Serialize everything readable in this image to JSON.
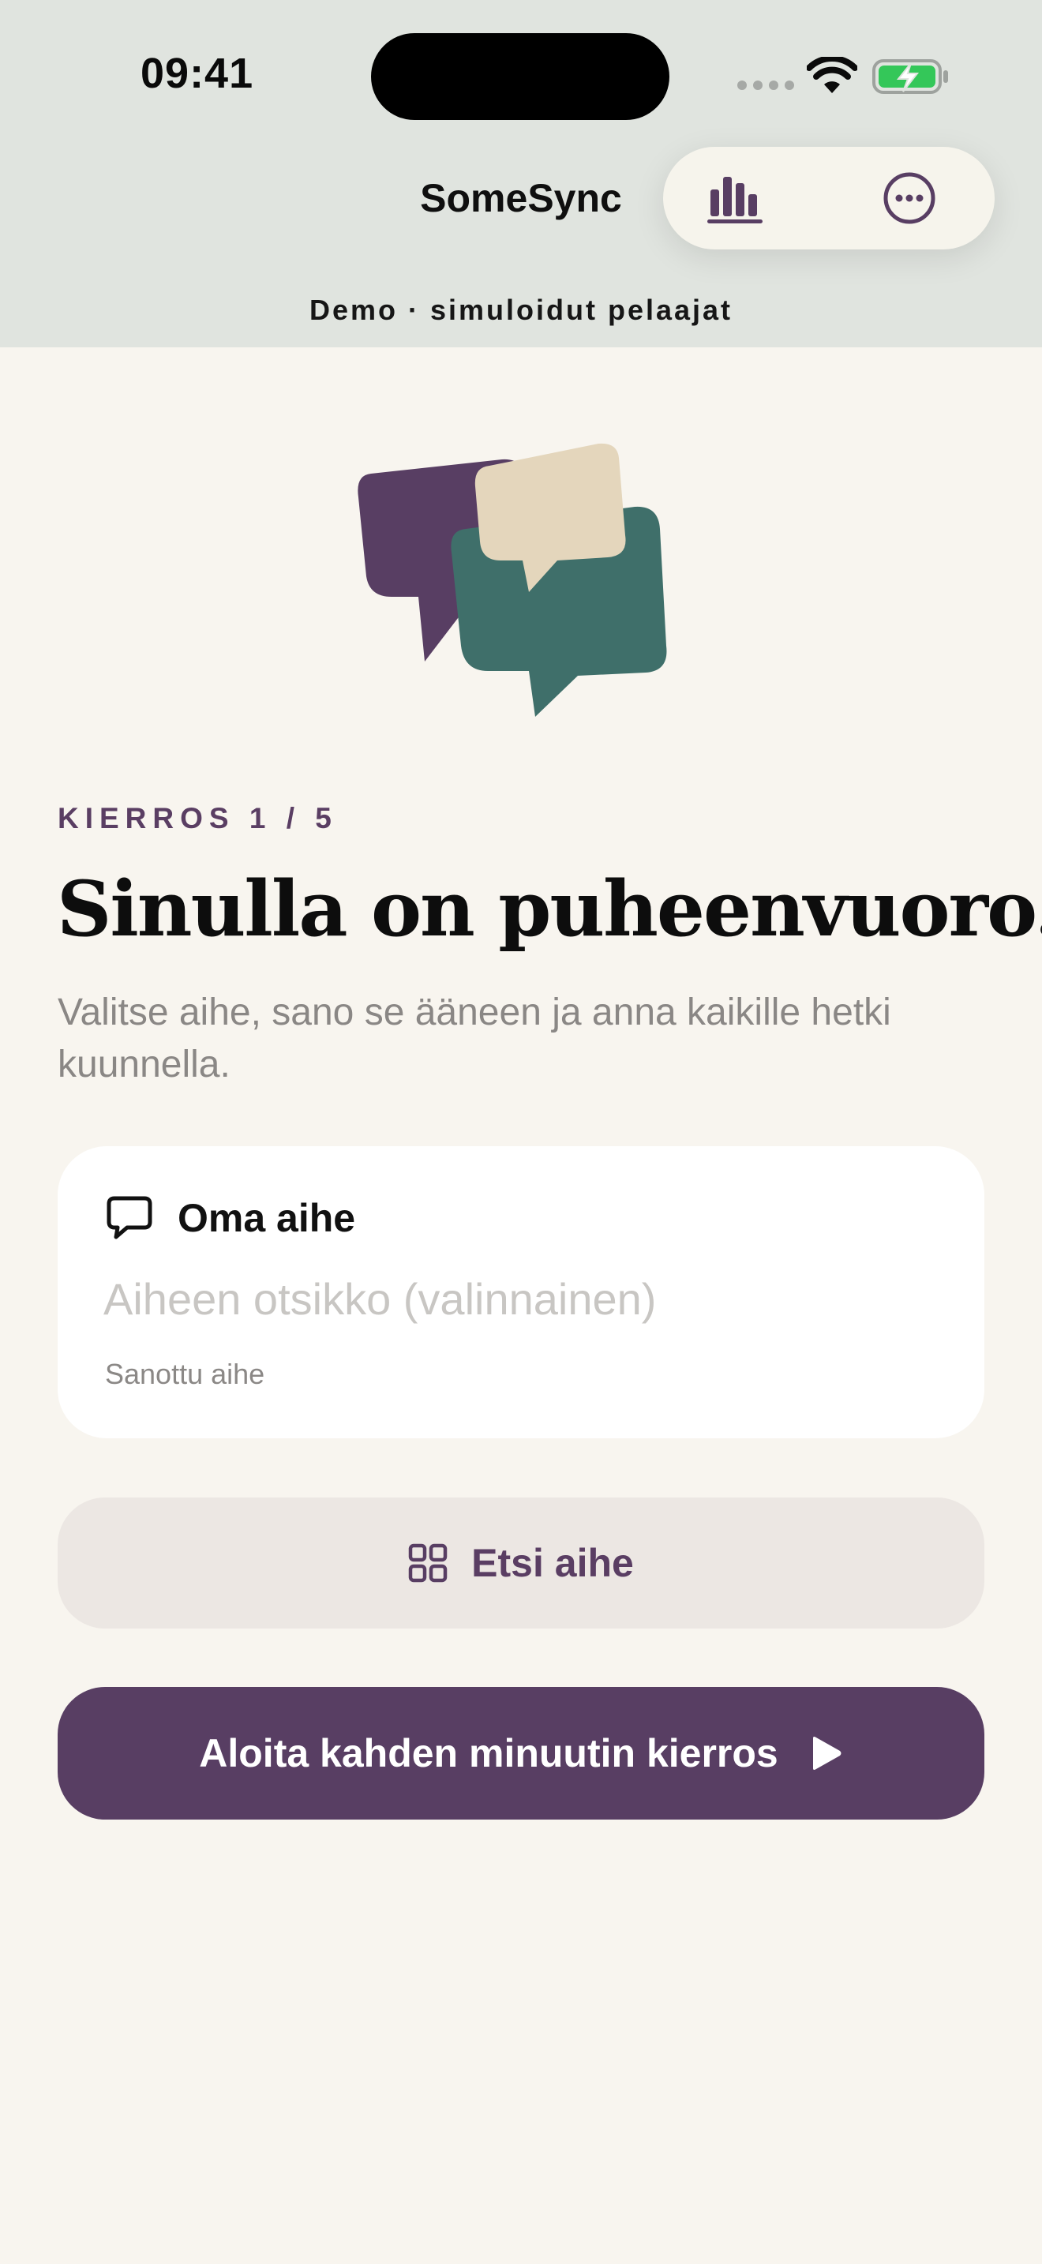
{
  "status_bar": {
    "time": "09:41"
  },
  "header": {
    "title": "SomeSync",
    "stats_icon": "bar-chart-icon",
    "more_icon": "ellipsis-circle-icon",
    "demo_banner": "Demo · simuloidut pelaajat"
  },
  "round": {
    "label": "KIERROS 1 / 5",
    "current": 1,
    "total": 5
  },
  "prompt": {
    "heading": "Sinulla on puheenvuoro.",
    "subheading": "Valitse aihe, sano se ääneen ja anna kaikille hetki kuunnella."
  },
  "topic_card": {
    "icon": "speech-bubble-icon",
    "title": "Oma aihe",
    "input_value": "",
    "input_placeholder": "Aiheen otsikko (valinnainen)",
    "caption": "Sanottu aihe"
  },
  "actions": {
    "browse_label": "Etsi aihe",
    "browse_icon": "grid-icon",
    "start_label": "Aloita kahden minuutin kierros",
    "start_icon": "play-icon"
  },
  "colors": {
    "header_bg": "#E0E4DF",
    "page_bg": "#F8F5EF",
    "accent_purple": "#583E63",
    "accent_green": "#3F6F6A",
    "accent_beige": "#E4D6BC",
    "secondary_button_bg": "#ECE7E3",
    "battery_green": "#34C759"
  }
}
